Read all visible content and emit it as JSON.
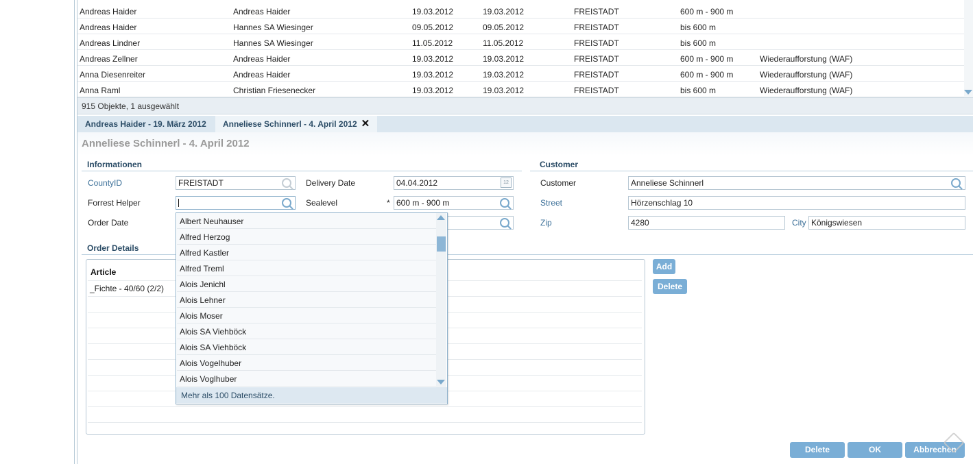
{
  "table": {
    "rows": [
      {
        "c1": "Andreas Haider",
        "c2": "Andreas Haider",
        "c3": "19.03.2012",
        "c4": "19.03.2012",
        "c5": "FREISTADT",
        "c6": "600 m - 900 m",
        "c7": ""
      },
      {
        "c1": "Andreas  Haider",
        "c2": "Hannes SA Wiesinger",
        "c3": "09.05.2012",
        "c4": "09.05.2012",
        "c5": "FREISTADT",
        "c6": "bis 600 m",
        "c7": ""
      },
      {
        "c1": "Andreas  Lindner",
        "c2": "Hannes SA Wiesinger",
        "c3": "11.05.2012",
        "c4": "11.05.2012",
        "c5": "FREISTADT",
        "c6": "bis 600 m",
        "c7": ""
      },
      {
        "c1": "Andreas  Zellner",
        "c2": "Andreas Haider",
        "c3": "19.03.2012",
        "c4": "19.03.2012",
        "c5": "FREISTADT",
        "c6": "600 m - 900 m",
        "c7": "Wiederaufforstung (WAF)"
      },
      {
        "c1": "Anna  Diesenreiter",
        "c2": "Andreas Haider",
        "c3": "19.03.2012",
        "c4": "19.03.2012",
        "c5": "FREISTADT",
        "c6": "600 m - 900 m",
        "c7": "Wiederaufforstung (WAF)"
      },
      {
        "c1": "Anna Raml",
        "c2": "Christian Friesenecker",
        "c3": "19.03.2012",
        "c4": "19.03.2012",
        "c5": "FREISTADT",
        "c6": "bis 600 m",
        "c7": "Wiederaufforstung (WAF)"
      }
    ],
    "status": "915 Objekte, 1 ausgewählt"
  },
  "tabs": [
    {
      "label": "Andreas Haider - 19. März 2012"
    },
    {
      "label": "Anneliese Schinnerl - 4. April 2012"
    }
  ],
  "tab_close": "✕",
  "page_title": "Anneliese Schinnerl - 4. April 2012",
  "informationen": {
    "title": "Informationen",
    "county_label": "CountyID",
    "county_value": "FREISTADT",
    "helper_label": "Forrest Helper",
    "helper_value": "",
    "order_date_label": "Order Date",
    "delivery_label": "Delivery Date",
    "delivery_value": "04.04.2012",
    "calendar_day": "12",
    "sealevel_label": "Sealevel",
    "sealevel_required": "*",
    "sealevel_value": "600 m - 900 m"
  },
  "customer": {
    "title": "Customer",
    "customer_label": "Customer",
    "customer_value": "Anneliese Schinnerl",
    "street_label": "Street",
    "street_value": "Hörzenschlag 10",
    "zip_label": "Zip",
    "zip_value": "4280",
    "city_label": "City",
    "city_value": "Königswiesen"
  },
  "order_details": {
    "title": "Order Details",
    "column_article": "Article",
    "rows": [
      "_Fichte - 40/60 (2/2)"
    ],
    "add_label": "Add",
    "delete_label": "Delete"
  },
  "dropdown": {
    "items": [
      "Albert Neuhauser",
      "Alfred Herzog",
      "Alfred Kastler",
      "Alfred Treml",
      "Alois Jenichl",
      "Alois Lehner",
      "Alois Moser",
      "Alois SA Viehböck",
      "Alois SA Viehböck",
      "Alois Vogelhuber",
      "Alois Voglhuber"
    ],
    "footer": "Mehr als 100 Datensätze."
  },
  "footer_buttons": {
    "delete": "Delete",
    "ok": "OK",
    "cancel": "Abbrechen"
  },
  "colors": {
    "accent": "#7aaed6",
    "tab_text": "#2b4c66",
    "label_blue": "#3b6f98"
  }
}
